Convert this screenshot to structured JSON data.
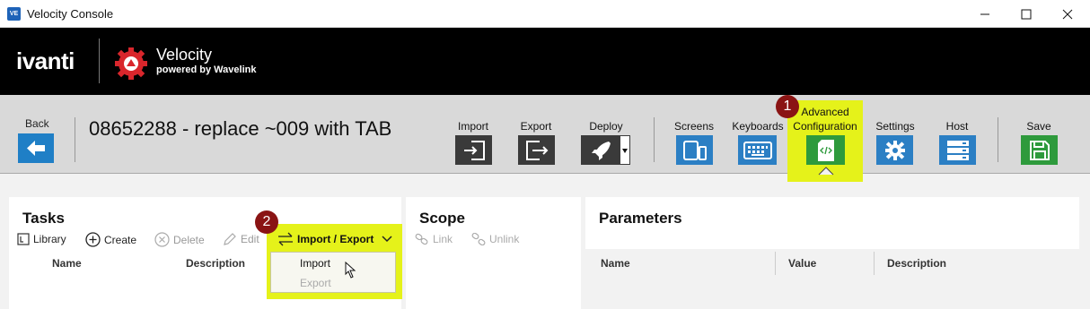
{
  "window": {
    "icon_text": "VE",
    "title": "Velocity Console"
  },
  "brand": {
    "ivanti": "ivanti",
    "product": "Velocity",
    "tagline": "powered by Wavelink"
  },
  "toolbar": {
    "back_label": "Back",
    "project_title": "08652288 - replace ~009 with TAB",
    "import_label": "Import",
    "export_label": "Export",
    "deploy_label": "Deploy",
    "screens_label": "Screens",
    "keyboards_label": "Keyboards",
    "advanced_label_1": "Advanced",
    "advanced_label_2": "Configuration",
    "settings_label": "Settings",
    "host_label": "Host",
    "save_label": "Save"
  },
  "callouts": {
    "step1": "1",
    "step2": "2"
  },
  "tasks": {
    "title": "Tasks",
    "actions": {
      "library": "Library",
      "create": "Create",
      "delete": "Delete",
      "edit": "Edit",
      "import_export": "Import / Export"
    },
    "columns": [
      "Name",
      "Description"
    ],
    "menu": {
      "items": [
        "Import",
        "Export"
      ]
    }
  },
  "scope": {
    "title": "Scope",
    "actions": {
      "link": "Link",
      "unlink": "Unlink"
    }
  },
  "parameters": {
    "title": "Parameters",
    "columns": [
      "Name",
      "Value",
      "Description"
    ]
  },
  "colors": {
    "highlight": "#e5f21a",
    "callout": "#8a1414",
    "blue_button": "#2b7fc4",
    "green_button": "#2e9a3c",
    "dark_button": "#3a3a3a"
  }
}
